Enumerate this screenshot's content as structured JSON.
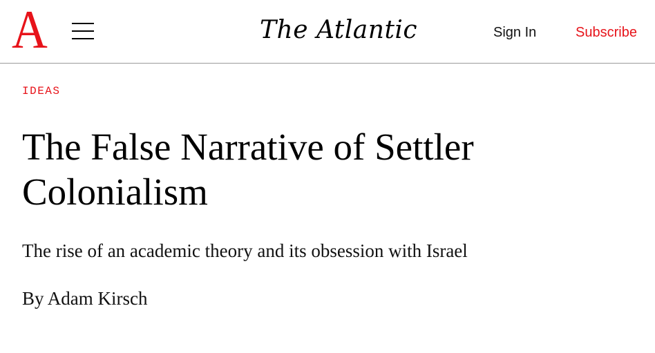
{
  "header": {
    "logo_letter": "A",
    "wordmark": "The Atlantic",
    "sign_in_label": "Sign In",
    "subscribe_label": "Subscribe",
    "accent_color": "#e7131a",
    "menu_icon": "hamburger-menu-icon"
  },
  "article": {
    "section": "IDEAS",
    "headline": "The False Narrative of Settler Colonialism",
    "dek": "The rise of an academic theory and its obsession with Israel",
    "byline_prefix": "By",
    "author": "Adam Kirsch"
  }
}
